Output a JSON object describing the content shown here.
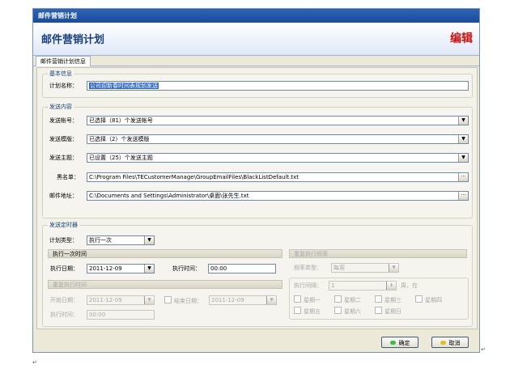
{
  "window": {
    "title": "邮件营销计划"
  },
  "header": {
    "title": "邮件营销计划",
    "mode": "编辑"
  },
  "tabs": [
    {
      "label": "邮件营销计划信息"
    }
  ],
  "basic": {
    "title": "基本信息",
    "name_label": "计划名称：",
    "name_value": "公司迎新春时间表规划发送"
  },
  "send": {
    "title": "发送内容",
    "accounts_label": "发送帐号：",
    "accounts_value": "已选择（81）个发送帐号",
    "templates_label": "发送模版：",
    "templates_value": "已选择（2）个发送模版",
    "subjects_label": "发送主题：",
    "subjects_value": "已设置（25）个发送主题",
    "blacklist_label": "黑名单：",
    "blacklist_value": "C:\\Program Files\\TECustomerManage\\GroupEmailFiles\\BlackListDefault.txt",
    "address_label": "邮件地址：",
    "address_value": "C:\\Documents and Settings\\Administrator\\桌面\\张先生.txt"
  },
  "timer": {
    "title": "发送定时器",
    "type_label": "计划类型：",
    "type_value": "执行一次",
    "once": {
      "title": "执行一次时间",
      "date_label": "执行日期：",
      "date_value": "2011-12-09",
      "time_label": "执行时间：",
      "time_value": "00:00"
    },
    "repeat": {
      "title": "重复执行时间",
      "start_label": "开始日期：",
      "start_value": "2011-12-09",
      "end_label": "结束日期：",
      "end_value": "2011-12-09",
      "time_label": "执行时间：",
      "time_value": "00:00"
    },
    "freq": {
      "title": "重复执行频率",
      "type_label": "频率类型：",
      "type_value": "每周",
      "interval_label": "执行间隔：",
      "interval_value": "1",
      "interval_unit": "周，在",
      "days": [
        "星期一",
        "星期二",
        "星期三",
        "星期四",
        "星期五",
        "星期六",
        "星期日"
      ]
    }
  },
  "footer": {
    "ok": "确定",
    "cancel": "取消"
  },
  "colors": {
    "ok_dot": "#3cbf3c",
    "cancel_dot": "#e0c020",
    "mode": "#d01010"
  }
}
